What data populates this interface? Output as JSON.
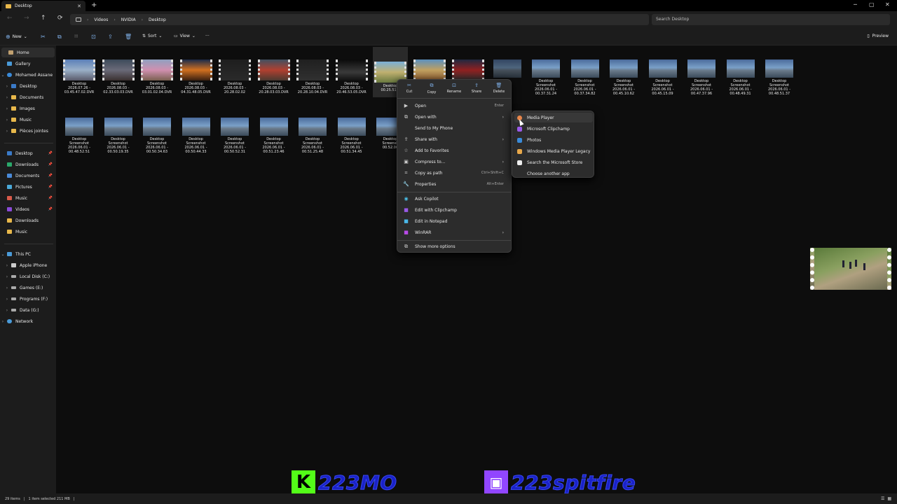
{
  "window": {
    "tab_title": "Desktop",
    "tab_close": "✕",
    "new_tab": "+",
    "minimize": "─",
    "maximize": "▢",
    "close": "✕"
  },
  "address": {
    "breadcrumbs": [
      "Videos",
      "NVIDIA",
      "Desktop"
    ],
    "separator": "›",
    "search_placeholder": "Search Desktop"
  },
  "commandbar": {
    "new_label": "New",
    "sort_label": "Sort",
    "view_label": "View",
    "more_label": "···",
    "preview_label": "Preview"
  },
  "sidebar": {
    "home": "Home",
    "gallery": "Gallery",
    "user": "Mohamed Assane",
    "user_folders": [
      "Desktop",
      "Documents",
      "Images",
      "Music",
      "Pièces jointes"
    ],
    "quick_access": [
      "Desktop",
      "Downloads",
      "Documents",
      "Pictures",
      "Music",
      "Videos",
      "Downloads",
      "Music"
    ],
    "this_pc": "This PC",
    "drives": [
      "Apple iPhone",
      "Local Disk (C:)",
      "Games (E:)",
      "Programs (F:)",
      "Data (G:)"
    ],
    "network": "Network"
  },
  "files_row1": [
    {
      "line1": "Desktop",
      "line2": "2026.07.26 -",
      "line3": "03.45.47.02.DVR"
    },
    {
      "line1": "Desktop",
      "line2": "2026.08.03 -",
      "line3": "02.33.03.03.DVR"
    },
    {
      "line1": "Desktop",
      "line2": "2026.08.03 -",
      "line3": "03.01.02.04.DVR"
    },
    {
      "line1": "Desktop",
      "line2": "2026.08.03 -",
      "line3": "04.31.48.05.DVR"
    },
    {
      "line1": "Desktop",
      "line2": "2026.08.03 -",
      "line3": "20.28.02.02"
    },
    {
      "line1": "Desktop",
      "line2": "2026.08.03 -",
      "line3": "20.28.03.03.DVR"
    },
    {
      "line1": "Desktop",
      "line2": "2026.08.03 -",
      "line3": "20.28.10.04.DVR"
    },
    {
      "line1": "Desktop",
      "line2": "2026.08.03 -",
      "line3": "20.46.53.05.DVR"
    },
    {
      "line1": "Desktop",
      "line2": "",
      "line3": "00.25.51.0"
    },
    {
      "line1": "",
      "line2": "",
      "line3": ""
    },
    {
      "line1": "",
      "line2": "",
      "line3": ""
    },
    {
      "line1": "p",
      "line2": "t",
      "line3": ".86"
    },
    {
      "line1": "Desktop Screenshot",
      "line2": "2026.06.01 -",
      "line3": "00.37.31.24"
    },
    {
      "line1": "Desktop Screenshot",
      "line2": "2026.06.01 -",
      "line3": "00.37.34.82"
    },
    {
      "line1": "Desktop Screenshot",
      "line2": "2026.06.01 -",
      "line3": "00.45.10.62"
    },
    {
      "line1": "Desktop Screenshot",
      "line2": "2026.06.01 -",
      "line3": "00.45.15.09"
    },
    {
      "line1": "Desktop Screenshot",
      "line2": "2026.06.01 -",
      "line3": "00.47.37.96"
    },
    {
      "line1": "Desktop Screenshot",
      "line2": "2026.06.01 -",
      "line3": "00.48.49.31"
    },
    {
      "line1": "Desktop Screenshot",
      "line2": "2026.06.01 -",
      "line3": "00.48.51.37"
    }
  ],
  "files_row2": [
    {
      "line1": "Desktop Screenshot",
      "line2": "2026.06.01 -",
      "line3": "00.48.52.51"
    },
    {
      "line1": "Desktop Screenshot",
      "line2": "2026.06.01 -",
      "line3": "00.50.19.35"
    },
    {
      "line1": "Desktop Screenshot",
      "line2": "2026.06.01 -",
      "line3": "00.50.34.63"
    },
    {
      "line1": "Desktop Screenshot",
      "line2": "2026.06.01 -",
      "line3": "00.50.44.33"
    },
    {
      "line1": "Desktop Screenshot",
      "line2": "2026.06.01 -",
      "line3": "00.50.52.31"
    },
    {
      "line1": "Desktop Screenshot",
      "line2": "2026.06.01 -",
      "line3": "00.51.23.46"
    },
    {
      "line1": "Desktop Screenshot",
      "line2": "2026.06.01 -",
      "line3": "00.51.25.48"
    },
    {
      "line1": "Desktop Screenshot",
      "line2": "2026.06.01 -",
      "line3": "00.51.34.45"
    },
    {
      "line1": "Desktop",
      "line2": "Screensh",
      "line3": "00.52.06"
    }
  ],
  "context_menu": {
    "quick_actions": [
      "Cut",
      "Copy",
      "Rename",
      "Share",
      "Delete"
    ],
    "items": [
      {
        "label": "Open",
        "shortcut": "Enter"
      },
      {
        "label": "Open with",
        "shortcut": ""
      },
      {
        "label": "Send to My Phone",
        "shortcut": ""
      },
      {
        "label": "Share with",
        "shortcut": ""
      },
      {
        "label": "Add to Favorites",
        "shortcut": ""
      },
      {
        "label": "Compress to...",
        "shortcut": ""
      },
      {
        "label": "Copy as path",
        "shortcut": "Ctrl+Shift+C"
      },
      {
        "label": "Properties",
        "shortcut": "Alt+Enter"
      },
      {
        "label": "Ask Copilot",
        "shortcut": ""
      },
      {
        "label": "Edit with Clipchamp",
        "shortcut": ""
      },
      {
        "label": "Edit in Notepad",
        "shortcut": ""
      },
      {
        "label": "WinRAR",
        "shortcut": ""
      },
      {
        "label": "Show more options",
        "shortcut": ""
      }
    ],
    "arrow": "›"
  },
  "open_with_submenu": {
    "items": [
      "Media Player",
      "Microsoft Clipchamp",
      "Photos",
      "Windows Media Player Legacy",
      "Search the Microsoft Store",
      "Choose another app"
    ]
  },
  "overlay": {
    "kick_logo": "K",
    "kick_name": "223MO",
    "twitch_logo": "▣",
    "twitch_name": "223spitfire",
    "kick_color": "#53fc18",
    "twitch_color": "#9146ff"
  },
  "statusbar": {
    "item_count": "29 items",
    "selection": "1 item selected  211 MB"
  }
}
